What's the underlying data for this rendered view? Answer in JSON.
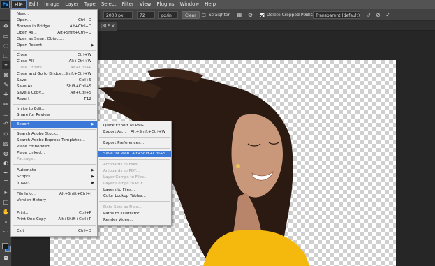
{
  "app": {
    "logo_text": "Ps"
  },
  "menubar": {
    "items": [
      "File",
      "Edit",
      "Image",
      "Layer",
      "Type",
      "Select",
      "Filter",
      "View",
      "Plugins",
      "Window",
      "Help"
    ]
  },
  "options": {
    "width_value": "2000 px",
    "resolution_value": "72",
    "resolution_unit": "px/in",
    "clear_label": "Clear",
    "straighten_label": "Straighten",
    "delete_cropped_label": "Delete Cropped Pixels",
    "fill_label": "Transparent (default)"
  },
  "document_tab": {
    "title": "(8) *"
  },
  "file_menu": {
    "items": [
      {
        "label": "New...",
        "shortcut": "",
        "disabled": false
      },
      {
        "label": "Open...",
        "shortcut": "Ctrl+O",
        "disabled": false
      },
      {
        "label": "Browse in Bridge...",
        "shortcut": "Alt+Ctrl+O",
        "disabled": false
      },
      {
        "label": "Open As...",
        "shortcut": "Alt+Shift+Ctrl+O",
        "disabled": false
      },
      {
        "label": "Open as Smart Object...",
        "shortcut": "",
        "disabled": false
      },
      {
        "label": "Open Recent",
        "shortcut": "",
        "disabled": false,
        "submenu": true
      },
      {
        "label": "Close",
        "shortcut": "Ctrl+W",
        "disabled": false
      },
      {
        "label": "Close All",
        "shortcut": "Alt+Ctrl+W",
        "disabled": false
      },
      {
        "label": "Close Others",
        "shortcut": "Alt+Ctrl+P",
        "disabled": true
      },
      {
        "label": "Close and Go to Bridge...",
        "shortcut": "Shift+Ctrl+W",
        "disabled": false
      },
      {
        "label": "Save",
        "shortcut": "Ctrl+S",
        "disabled": false
      },
      {
        "label": "Save As...",
        "shortcut": "Shift+Ctrl+S",
        "disabled": false
      },
      {
        "label": "Save a Copy...",
        "shortcut": "Alt+Ctrl+S",
        "disabled": false
      },
      {
        "label": "Revert",
        "shortcut": "F12",
        "disabled": false
      },
      {
        "label": "Invite to Edit...",
        "shortcut": "",
        "disabled": false
      },
      {
        "label": "Share for Review",
        "shortcut": "",
        "disabled": false
      },
      {
        "label": "Export",
        "shortcut": "",
        "disabled": false,
        "submenu": true,
        "highlighted": true
      },
      {
        "label": "Search Adobe Stock...",
        "shortcut": "",
        "disabled": false
      },
      {
        "label": "Search Adobe Express Templates...",
        "shortcut": "",
        "disabled": false
      },
      {
        "label": "Place Embedded...",
        "shortcut": "",
        "disabled": false
      },
      {
        "label": "Place Linked...",
        "shortcut": "",
        "disabled": false
      },
      {
        "label": "Package...",
        "shortcut": "",
        "disabled": true
      },
      {
        "label": "Automate",
        "shortcut": "",
        "disabled": false,
        "submenu": true
      },
      {
        "label": "Scripts",
        "shortcut": "",
        "disabled": false,
        "submenu": true
      },
      {
        "label": "Import",
        "shortcut": "",
        "disabled": false,
        "submenu": true
      },
      {
        "label": "File Info...",
        "shortcut": "Alt+Shift+Ctrl+I",
        "disabled": false
      },
      {
        "label": "Version History",
        "shortcut": "",
        "disabled": false
      },
      {
        "label": "Print...",
        "shortcut": "Ctrl+P",
        "disabled": false
      },
      {
        "label": "Print One Copy",
        "shortcut": "Alt+Shift+Ctrl+P",
        "disabled": false
      },
      {
        "label": "Exit",
        "shortcut": "Ctrl+Q",
        "disabled": false
      }
    ]
  },
  "export_menu": {
    "items": [
      {
        "label": "Quick Export as PNG",
        "shortcut": "",
        "disabled": false
      },
      {
        "label": "Export As...",
        "shortcut": "Alt+Shift+Ctrl+W",
        "disabled": false
      },
      {
        "label": "Export Preferences...",
        "shortcut": "",
        "disabled": false
      },
      {
        "label": "Save for Web...",
        "shortcut": "Alt+Shift+Ctrl+S",
        "disabled": false,
        "highlighted": true
      },
      {
        "label": "Artboards to Files...",
        "shortcut": "",
        "disabled": true
      },
      {
        "label": "Artboards to PDF...",
        "shortcut": "",
        "disabled": true
      },
      {
        "label": "Layer Comps to Files...",
        "shortcut": "",
        "disabled": true
      },
      {
        "label": "Layer Comps to PDF...",
        "shortcut": "",
        "disabled": true
      },
      {
        "label": "Layers to Files...",
        "shortcut": "",
        "disabled": false
      },
      {
        "label": "Color Lookup Tables...",
        "shortcut": "",
        "disabled": false
      },
      {
        "label": "Data Sets as Files...",
        "shortcut": "",
        "disabled": true
      },
      {
        "label": "Paths to Illustrator...",
        "shortcut": "",
        "disabled": false
      },
      {
        "label": "Render Video...",
        "shortcut": "",
        "disabled": false
      }
    ]
  },
  "colors": {
    "accent": "#3b78d8",
    "foreground": "#1a1a1a",
    "background": "#2a6db5"
  }
}
